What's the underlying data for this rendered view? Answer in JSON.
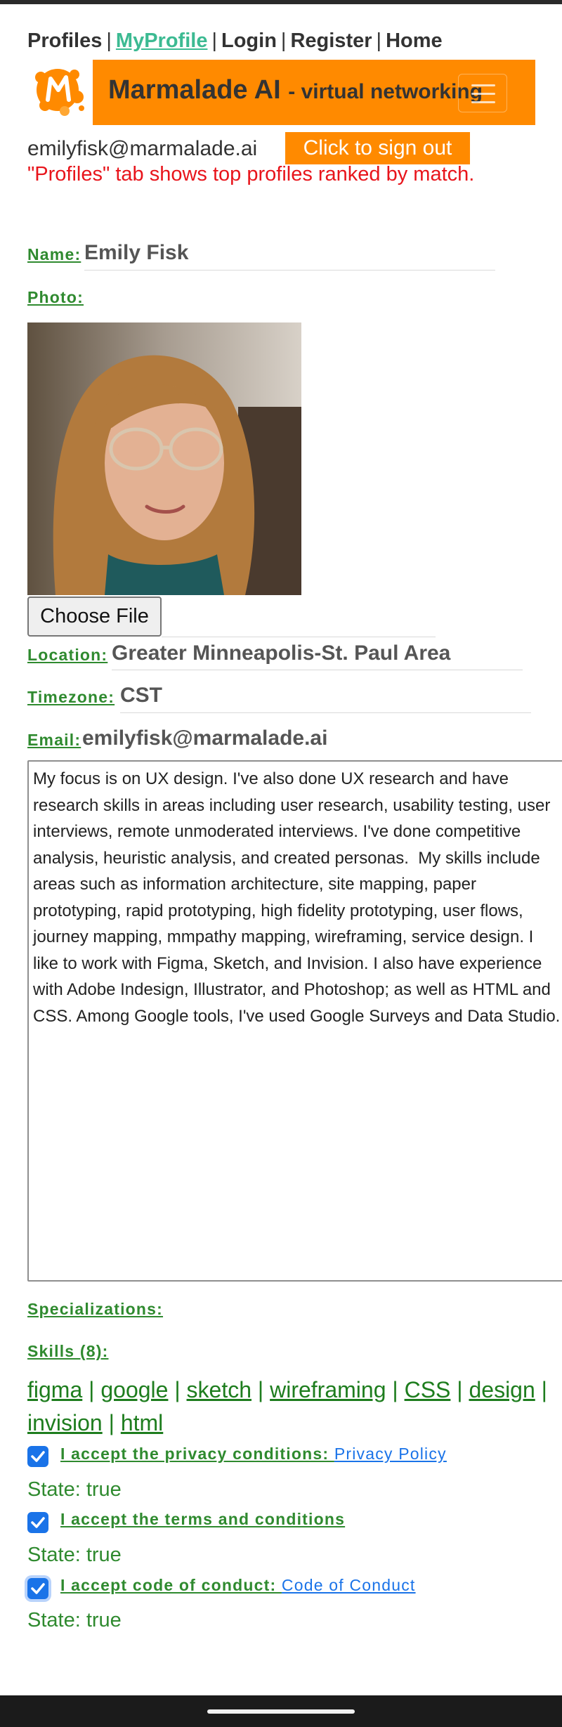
{
  "nav": {
    "items": [
      {
        "label": "Profiles",
        "active": false
      },
      {
        "label": "MyProfile",
        "active": true
      },
      {
        "label": "Login",
        "active": false
      },
      {
        "label": "Register",
        "active": false
      },
      {
        "label": "Home",
        "active": false
      }
    ],
    "separator": "|"
  },
  "banner": {
    "title": "Marmalade AI",
    "subtitle": "- virtual networking",
    "logo_icon": "marmalade-m-logo",
    "menu_icon": "hamburger-icon"
  },
  "account": {
    "email": "emilyfisk@marmalade.ai",
    "signout_label": "Click to sign out",
    "note": "\"Profiles\" tab shows top profiles ranked by match."
  },
  "profile": {
    "name_label": "Name:",
    "name_value": "Emily Fisk",
    "photo_label": "Photo:",
    "choose_file_label": "Choose File",
    "location_label": "Location:",
    "location_value": "Greater Minneapolis-St. Paul Area",
    "timezone_label": "Timezone:",
    "timezone_value": "CST",
    "email_label": "Email:",
    "email_value": "emilyfisk@marmalade.ai",
    "bio": "My focus is on UX design. I've also done UX research and have research skills in areas including user research, usability testing, user interviews, remote unmoderated interviews. I've done competitive analysis, heuristic analysis, and created personas.  My skills include areas such as information architecture, site mapping, paper prototyping, rapid prototyping, high fidelity prototyping, user flows, journey mapping, mmpathy mapping, wireframing, service design. I like to work with Figma, Sketch, and Invision. I also have experience with Adobe Indesign, Illustrator, and Photoshop; as well as HTML and CSS. Among Google tools, I've used Google Surveys and Data Studio.",
    "specializations_label": "Specializations:",
    "skills_label": "Skills (8):",
    "skills": [
      "figma",
      "google",
      "sketch",
      "wireframing",
      "CSS",
      "design",
      "invision",
      "html"
    ]
  },
  "consents": [
    {
      "label": "I accept the privacy conditions: ",
      "link": "Privacy Policy",
      "checked": true,
      "state": "State: true"
    },
    {
      "label": "I accept the terms and conditions",
      "link": "",
      "checked": true,
      "state": "State: true"
    },
    {
      "label": "I accept code of conduct: ",
      "link": "Code of Conduct",
      "checked": true,
      "state": "State: true"
    }
  ],
  "colors": {
    "accent_orange": "#ff8a00",
    "label_green": "#2f8a2f",
    "link_blue": "#1a73e8",
    "alert_red": "#e8141b",
    "active_nav": "#3cba92"
  }
}
